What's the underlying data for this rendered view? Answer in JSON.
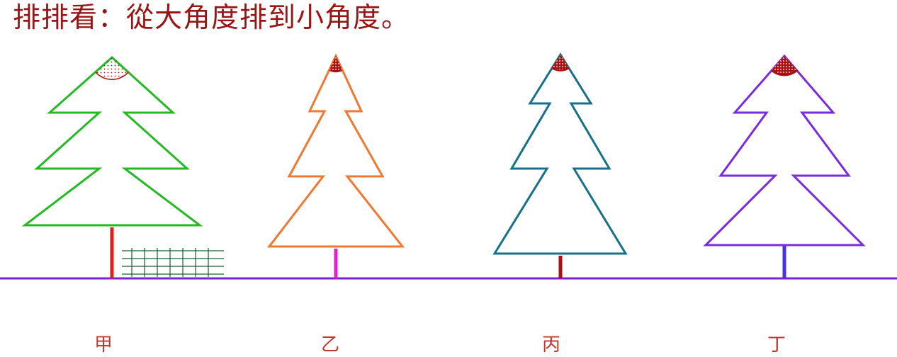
{
  "title": "排排看：從大角度排到小角度。",
  "trees": [
    {
      "label": "甲",
      "color": "#22bb22",
      "trunk_color": "#e31c1c"
    },
    {
      "label": "乙",
      "color": "#f07830",
      "trunk_color": "#e020d0"
    },
    {
      "label": "丙",
      "color": "#17708a",
      "trunk_color": "#aa1111"
    },
    {
      "label": "丁",
      "color": "#7a2be0",
      "trunk_color": "#4433ee"
    }
  ],
  "colors": {
    "ground": "#7a1fe0",
    "angle_mark": "#aa1111",
    "grid": "#1f5a33",
    "title": "#9a1414"
  }
}
